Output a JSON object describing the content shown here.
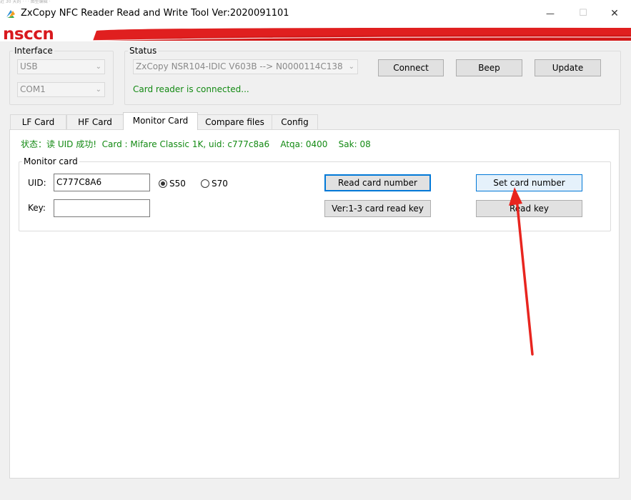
{
  "window": {
    "title": "ZxCopy NFC Reader Read and Write Tool  Ver:2020091101",
    "top_strip_text": "近 30 天的 · · · 图型编辑 ·",
    "min_glyph": "—",
    "max_glyph": "☐",
    "close_glyph": "✕"
  },
  "banner": {
    "logo_text": "nsccn",
    "accent_color": "#e02020"
  },
  "interface": {
    "legend": "Interface",
    "type_value": "USB",
    "port_value": "COM1"
  },
  "status": {
    "legend": "Status",
    "device_value": "ZxCopy NSR104-IDIC V603B --> N0000114C138",
    "message": "Card reader is connected...",
    "buttons": {
      "connect": "Connect",
      "beep": "Beep",
      "update": "Update"
    }
  },
  "tabs": [
    "LF Card",
    "HF Card",
    "Monitor Card",
    "Compare files",
    "Config"
  ],
  "monitor": {
    "status_line": "状态：读 UID 成功!  Card : Mifare Classic 1K, uid: c777c8a6    Atqa: 0400    Sak: 08",
    "group_legend": "Monitor card",
    "uid_label": "UID:",
    "uid_value": "C777C8A6",
    "key_label": "Key:",
    "key_value": "",
    "radio_s50": "S50",
    "radio_s70": "S70",
    "read_card_number": "Read card number",
    "set_card_number": "Set card number",
    "card_read_key": "Ver:1-3 card read key",
    "read_key": "Read key"
  },
  "colors": {
    "status_green": "#138a13",
    "arrow_red": "#e8251f"
  }
}
